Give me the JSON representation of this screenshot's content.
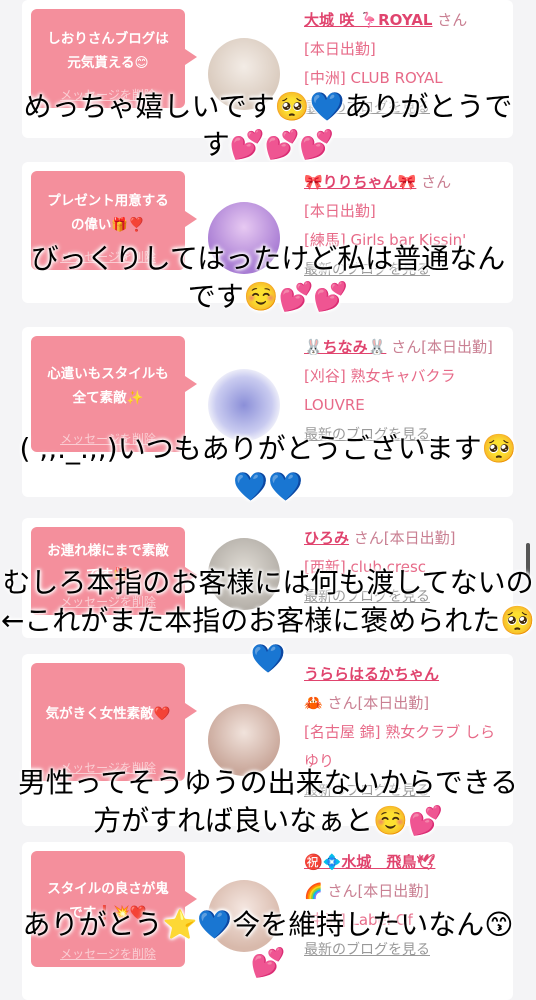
{
  "cards": [
    {
      "bubble": "しおりさんブログは元気貰える😊",
      "delete": "メッセージを削除",
      "name": "大城 咲 🦩ROYAL",
      "suffix": "さん",
      "status": "[本日出勤]",
      "shop": "[中洲] CLUB ROYAL",
      "latest": "最新のブログを見る",
      "avatar_color": "#e8ddd3"
    },
    {
      "bubble": "プレゼント用意するの偉い🎁❣️",
      "delete": "メッセージを削除",
      "name": "🎀りりちゃん🎀",
      "suffix": "さん",
      "status": "[本日出勤]",
      "shop": "[練馬] Girls bar Kissin'",
      "latest": "最新のブログを見る",
      "avatar_color": "#b48ad8"
    },
    {
      "bubble": "心遣いもスタイルも全て素敵✨",
      "delete": "メッセージを削除",
      "name": "🐰ちなみ🐰",
      "suffix": "さん[本日出勤]",
      "status": "",
      "shop": "[刈谷] 熟女キャバクラ LOUVRE",
      "latest": "最新のブログを見る",
      "avatar_color": "#9ea2dc"
    },
    {
      "bubble": "お連れ様にまで素敵です🎁",
      "delete": "メッセージを削除",
      "name": "ひろみ",
      "suffix": "さん[本日出勤]",
      "status": "",
      "shop": "[西新] club cresc",
      "latest": "最新のブログを見る",
      "avatar_color": "#c9c4bd"
    },
    {
      "bubble": "気がきく女性素敵❤️",
      "delete": "メッセージを削除",
      "name": "うららはるかちゃん",
      "suffix": "🦀 さん[本日出勤]",
      "status": "",
      "shop": "[名古屋 錦] 熟女クラブ しらゆり",
      "latest": "最新のブログを見る",
      "avatar_color": "#d8c2b9"
    },
    {
      "bubble": "スタイルの良さが鬼です❗️💥❤️",
      "delete": "メッセージを削除",
      "name": "㊗️💠水城　飛鳥🕊",
      "suffix": "🌈 さん[本日出勤]",
      "status": "",
      "shop": "[中洲] Label Of",
      "latest": "最新のブログを見る",
      "avatar_color": "#e6cfc4"
    }
  ],
  "overlays": [
    "めっちゃ嬉しいです🥺💙ありがとうです💕💕💕",
    "びっくりしてはったけど私は普通なんです☺️💕💕",
    "( ,,._.,,)いつもありがとうございます🥺💙💙",
    "むしろ本指のお客様には何も渡してないの←これがまた本指のお客様に褒められた🥺💙",
    "男性ってそうゆうの出来ないからできる方がすれば良いなぁと☺️💕",
    "ありがとう⭐️💙今を維持したいなん😙💕"
  ]
}
